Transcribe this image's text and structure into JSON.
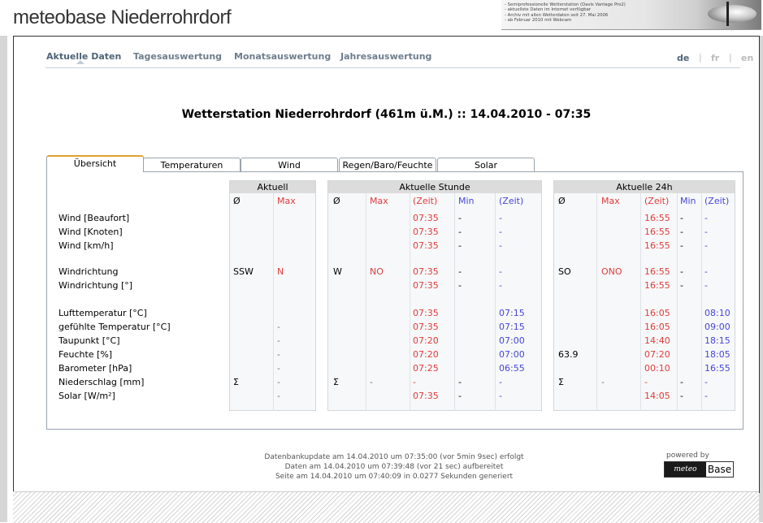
{
  "site": {
    "title": "meteobase Niederrohrdorf",
    "banner_lines": [
      "- Semiprofessionelle Wetterstation (Davis Vantage Pro2)",
      "- aktuellste Daten im Internet verfügbar",
      "- Archiv mit allen Wetterdaten seit 27. Mai 2006",
      "- ab Februar 2010 mit Webcam"
    ]
  },
  "nav": {
    "items": [
      "Aktuelle Daten",
      "Tagesauswertung",
      "Monatsauswertung",
      "Jahresauswertung"
    ],
    "active_index": 0,
    "languages": [
      "de",
      "fr",
      "en"
    ],
    "active_language": "de",
    "separator": "|"
  },
  "page": {
    "heading": "Wetterstation Niederrohrdorf (461m ü.M.) :: 14.04.2010 - 07:35"
  },
  "tabs": {
    "items": [
      "Übersicht",
      "Temperaturen",
      "Wind",
      "Regen/Baro/Feuchte",
      "Solar"
    ],
    "active_index": 0
  },
  "table": {
    "groups": [
      "Aktuell",
      "Aktuelle Stunde",
      "Aktuelle 24h"
    ],
    "subheaders": {
      "avg": "Ø",
      "max": "Max",
      "time": "(Zeit)",
      "min": "Min"
    },
    "rows": [
      {
        "label": "Wind [Beaufort]",
        "cur_avg": "",
        "cur_max": "",
        "h_avg": "",
        "h_max": "",
        "h_max_t": "07:35",
        "h_min": "-",
        "h_min_t": "-",
        "d_avg": "",
        "d_max": "",
        "d_max_t": "16:55",
        "d_min": "-",
        "d_min_t": "-"
      },
      {
        "label": "Wind [Knoten]",
        "cur_avg": "",
        "cur_max": "",
        "h_avg": "",
        "h_max": "",
        "h_max_t": "07:35",
        "h_min": "-",
        "h_min_t": "-",
        "d_avg": "",
        "d_max": "",
        "d_max_t": "16:55",
        "d_min": "-",
        "d_min_t": "-"
      },
      {
        "label": "Wind [km/h]",
        "cur_avg": "",
        "cur_max": "",
        "h_avg": "",
        "h_max": "",
        "h_max_t": "07:35",
        "h_min": "-",
        "h_min_t": "-",
        "d_avg": "",
        "d_max": "",
        "d_max_t": "16:55",
        "d_min": "-",
        "d_min_t": "-"
      },
      {
        "label": "Windrichtung",
        "cur_avg": "SSW",
        "cur_max": "N",
        "h_avg": "W",
        "h_max": "NO",
        "h_max_t": "07:35",
        "h_min": "-",
        "h_min_t": "-",
        "d_avg": "SO",
        "d_max": "ONO",
        "d_max_t": "16:55",
        "d_min": "-",
        "d_min_t": "-"
      },
      {
        "label": "Windrichtung [°]",
        "cur_avg": "",
        "cur_max": "",
        "h_avg": "",
        "h_max": "",
        "h_max_t": "07:35",
        "h_min": "-",
        "h_min_t": "-",
        "d_avg": "",
        "d_max": "",
        "d_max_t": "16:55",
        "d_min": "-",
        "d_min_t": "-"
      },
      {
        "label": "Lufttemperatur [°C]",
        "cur_avg": "",
        "cur_max": "",
        "h_avg": "",
        "h_max": "",
        "h_max_t": "07:35",
        "h_min": "",
        "h_min_t": "07:15",
        "d_avg": "",
        "d_max": "",
        "d_max_t": "16:05",
        "d_min": "",
        "d_min_t": "08:10"
      },
      {
        "label": "gefühlte Temperatur [°C]",
        "cur_avg": "",
        "cur_max": "-",
        "h_avg": "",
        "h_max": "",
        "h_max_t": "07:35",
        "h_min": "",
        "h_min_t": "07:15",
        "d_avg": "",
        "d_max": "",
        "d_max_t": "16:05",
        "d_min": "",
        "d_min_t": "09:00"
      },
      {
        "label": "Taupunkt [°C]",
        "cur_avg": "",
        "cur_max": "-",
        "h_avg": "",
        "h_max": "",
        "h_max_t": "07:20",
        "h_min": "",
        "h_min_t": "07:00",
        "d_avg": "",
        "d_max": "",
        "d_max_t": "14:40",
        "d_min": "",
        "d_min_t": "18:15"
      },
      {
        "label": "Feuchte [%]",
        "cur_avg": "",
        "cur_max": "-",
        "h_avg": "",
        "h_max": "",
        "h_max_t": "07:20",
        "h_min": "",
        "h_min_t": "07:00",
        "d_avg": "63.9",
        "d_max": "",
        "d_max_t": "07:20",
        "d_min": "",
        "d_min_t": "18:05"
      },
      {
        "label": "Barometer [hPa]",
        "cur_avg": "",
        "cur_max": "-",
        "h_avg": "",
        "h_max": "",
        "h_max_t": "07:25",
        "h_min": "",
        "h_min_t": "06:55",
        "d_avg": "",
        "d_max": "",
        "d_max_t": "00:10",
        "d_min": "",
        "d_min_t": "16:55"
      },
      {
        "label": "Niederschlag [mm]",
        "cur_avg": "Σ",
        "cur_max": "-",
        "h_avg": "Σ",
        "h_max": "-",
        "h_max_t": "-",
        "h_min": "-",
        "h_min_t": "-",
        "d_avg": "Σ",
        "d_max": "-",
        "d_max_t": "-",
        "d_min": "-",
        "d_min_t": "-"
      },
      {
        "label": "Solar [W/m²]",
        "cur_avg": "",
        "cur_max": "-",
        "h_avg": "",
        "h_max": "",
        "h_max_t": "07:35",
        "h_min": "-",
        "h_min_t": "-",
        "d_avg": "",
        "d_max": "",
        "d_max_t": "14:05",
        "d_min": "-",
        "d_min_t": "-"
      }
    ]
  },
  "footer": {
    "lines": [
      "Datenbankupdate am 14.04.2010 um 07:35:00 (vor 5min 9sec) erfolgt",
      "Daten am 14.04.2010 um 07:39:48 (vor 21 sec) aufbereitet",
      "Seite am 14.04.2010 um 07:40:09 in 0.0277 Sekunden generiert"
    ],
    "powered_by": "powered by",
    "logo_left": "meteo",
    "logo_right": "Base"
  },
  "colors": {
    "max": "#e03c3c",
    "min": "#4646d8",
    "tab_accent": "#e0a030",
    "nav": "#6e7d8c"
  }
}
